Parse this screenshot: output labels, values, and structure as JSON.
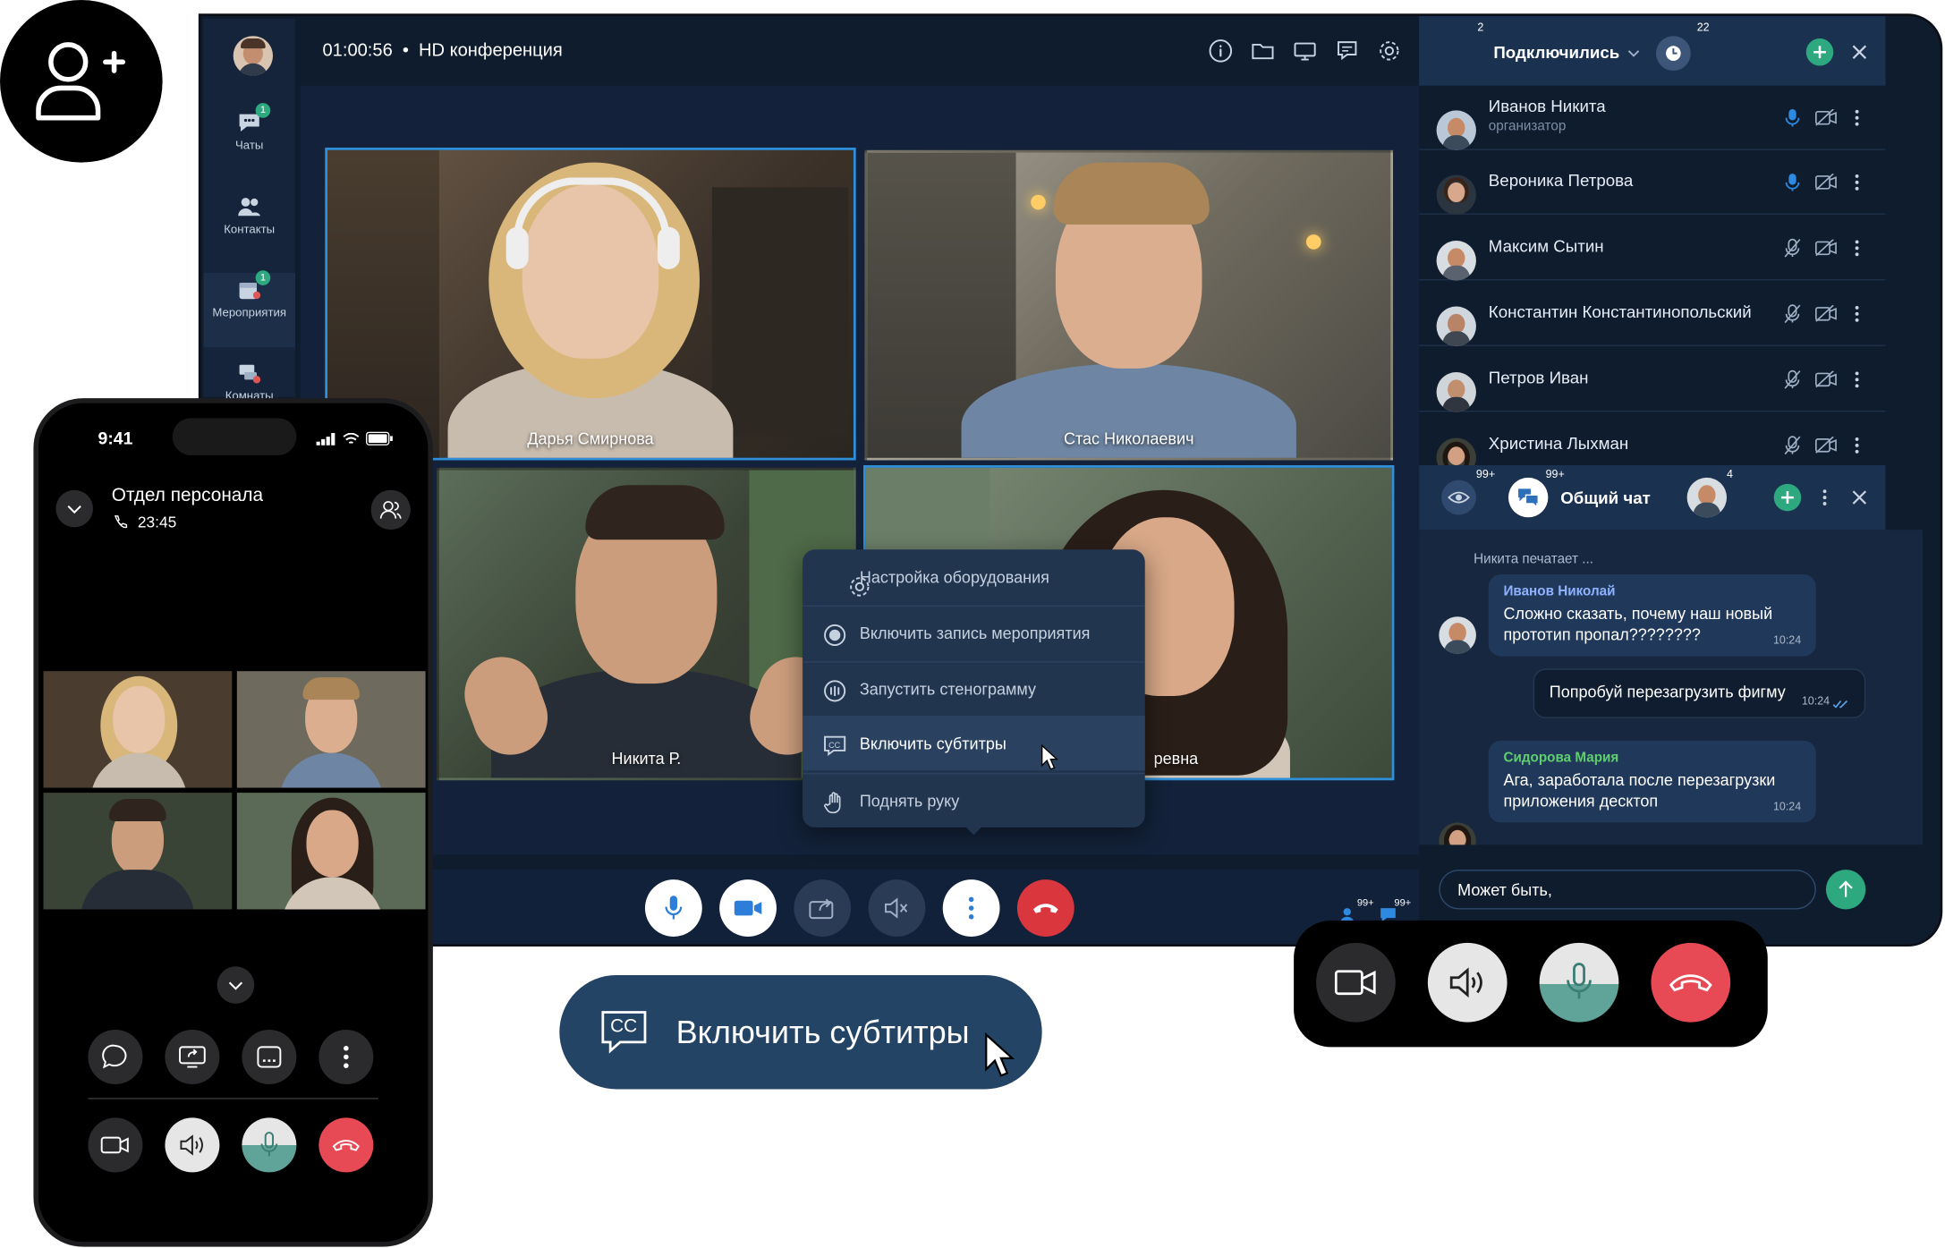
{
  "window": {
    "timer": "01:00:56",
    "bullet": "•",
    "title": "HD конференция"
  },
  "sidebar": {
    "items": [
      {
        "label": "Чаты",
        "badge": "1",
        "icon": "chat-icon"
      },
      {
        "label": "Контакты",
        "badge": "",
        "icon": "contacts-icon"
      },
      {
        "label": "Мероприятия",
        "badge": "1",
        "icon": "calendar-icon"
      },
      {
        "label": "Комнаты",
        "badge": "",
        "icon": "rooms-icon"
      }
    ]
  },
  "toolbar": {
    "icons": [
      "info-icon",
      "folder-icon",
      "screen-share-icon",
      "whiteboard-icon",
      "gear-icon",
      "stats-icon"
    ]
  },
  "video_tiles": [
    {
      "name": "Дарья Смирнова",
      "active": true
    },
    {
      "name": "Стас Николаевич",
      "active": false
    },
    {
      "name": "Никита Р.",
      "active": false
    },
    {
      "name": "ревна",
      "active": true
    }
  ],
  "context_menu": {
    "items": [
      {
        "label": "Настройка оборудования",
        "icon": "gear-icon"
      },
      {
        "label": "Включить запись мероприятия",
        "icon": "record-icon"
      },
      {
        "label": "Запустить стенограмму",
        "icon": "transcript-icon"
      },
      {
        "label": "Включить субтитры",
        "icon": "cc-icon"
      },
      {
        "label": "Поднять руку",
        "icon": "hand-icon"
      }
    ]
  },
  "controls": {
    "participants_count": "99+",
    "chat_count": "99+"
  },
  "participants_panel": {
    "count_left": "2",
    "count_right": "22",
    "filter_label": "Подключились",
    "participants": [
      {
        "name": "Иванов Никита",
        "role": "организатор",
        "mic_on": true
      },
      {
        "name": "Вероника Петрова",
        "role": "",
        "mic_on": true
      },
      {
        "name": "Максим Сытин",
        "role": "",
        "mic_on": false
      },
      {
        "name": "Константин Константинопольский",
        "role": "",
        "mic_on": false
      },
      {
        "name": "Петров Иван",
        "role": "",
        "mic_on": false
      },
      {
        "name": "Христина Лыхман",
        "role": "",
        "mic_on": false
      }
    ]
  },
  "chat": {
    "badge_left": "99+",
    "badge_mid": "99+",
    "badge_right": "4",
    "title": "Общий чат",
    "typing": "Никита печатает ...",
    "messages": [
      {
        "author": "Иванов Николай",
        "text1": "Сложно сказать, почему наш новый",
        "text2": "прототип пропал????????",
        "time": "10:24",
        "author_color": "#8fb3ff"
      },
      {
        "author": "",
        "text1": "Попробуй перезагрузить фигму",
        "text2": "",
        "time": "10:24",
        "author_color": ""
      },
      {
        "author": "Сидорова Мария",
        "text1": "Ага, заработала после перезагрузки",
        "text2": "приложения десктоп",
        "time": "10:24",
        "author_color": "#5fcf6d"
      }
    ],
    "input_value": "Может быть,"
  },
  "phone": {
    "time": "9:41",
    "call_title": "Отдел персонала",
    "call_duration": "23:45"
  },
  "caption_pill": {
    "cc_text": "CC",
    "label": "Включить субтитры"
  }
}
